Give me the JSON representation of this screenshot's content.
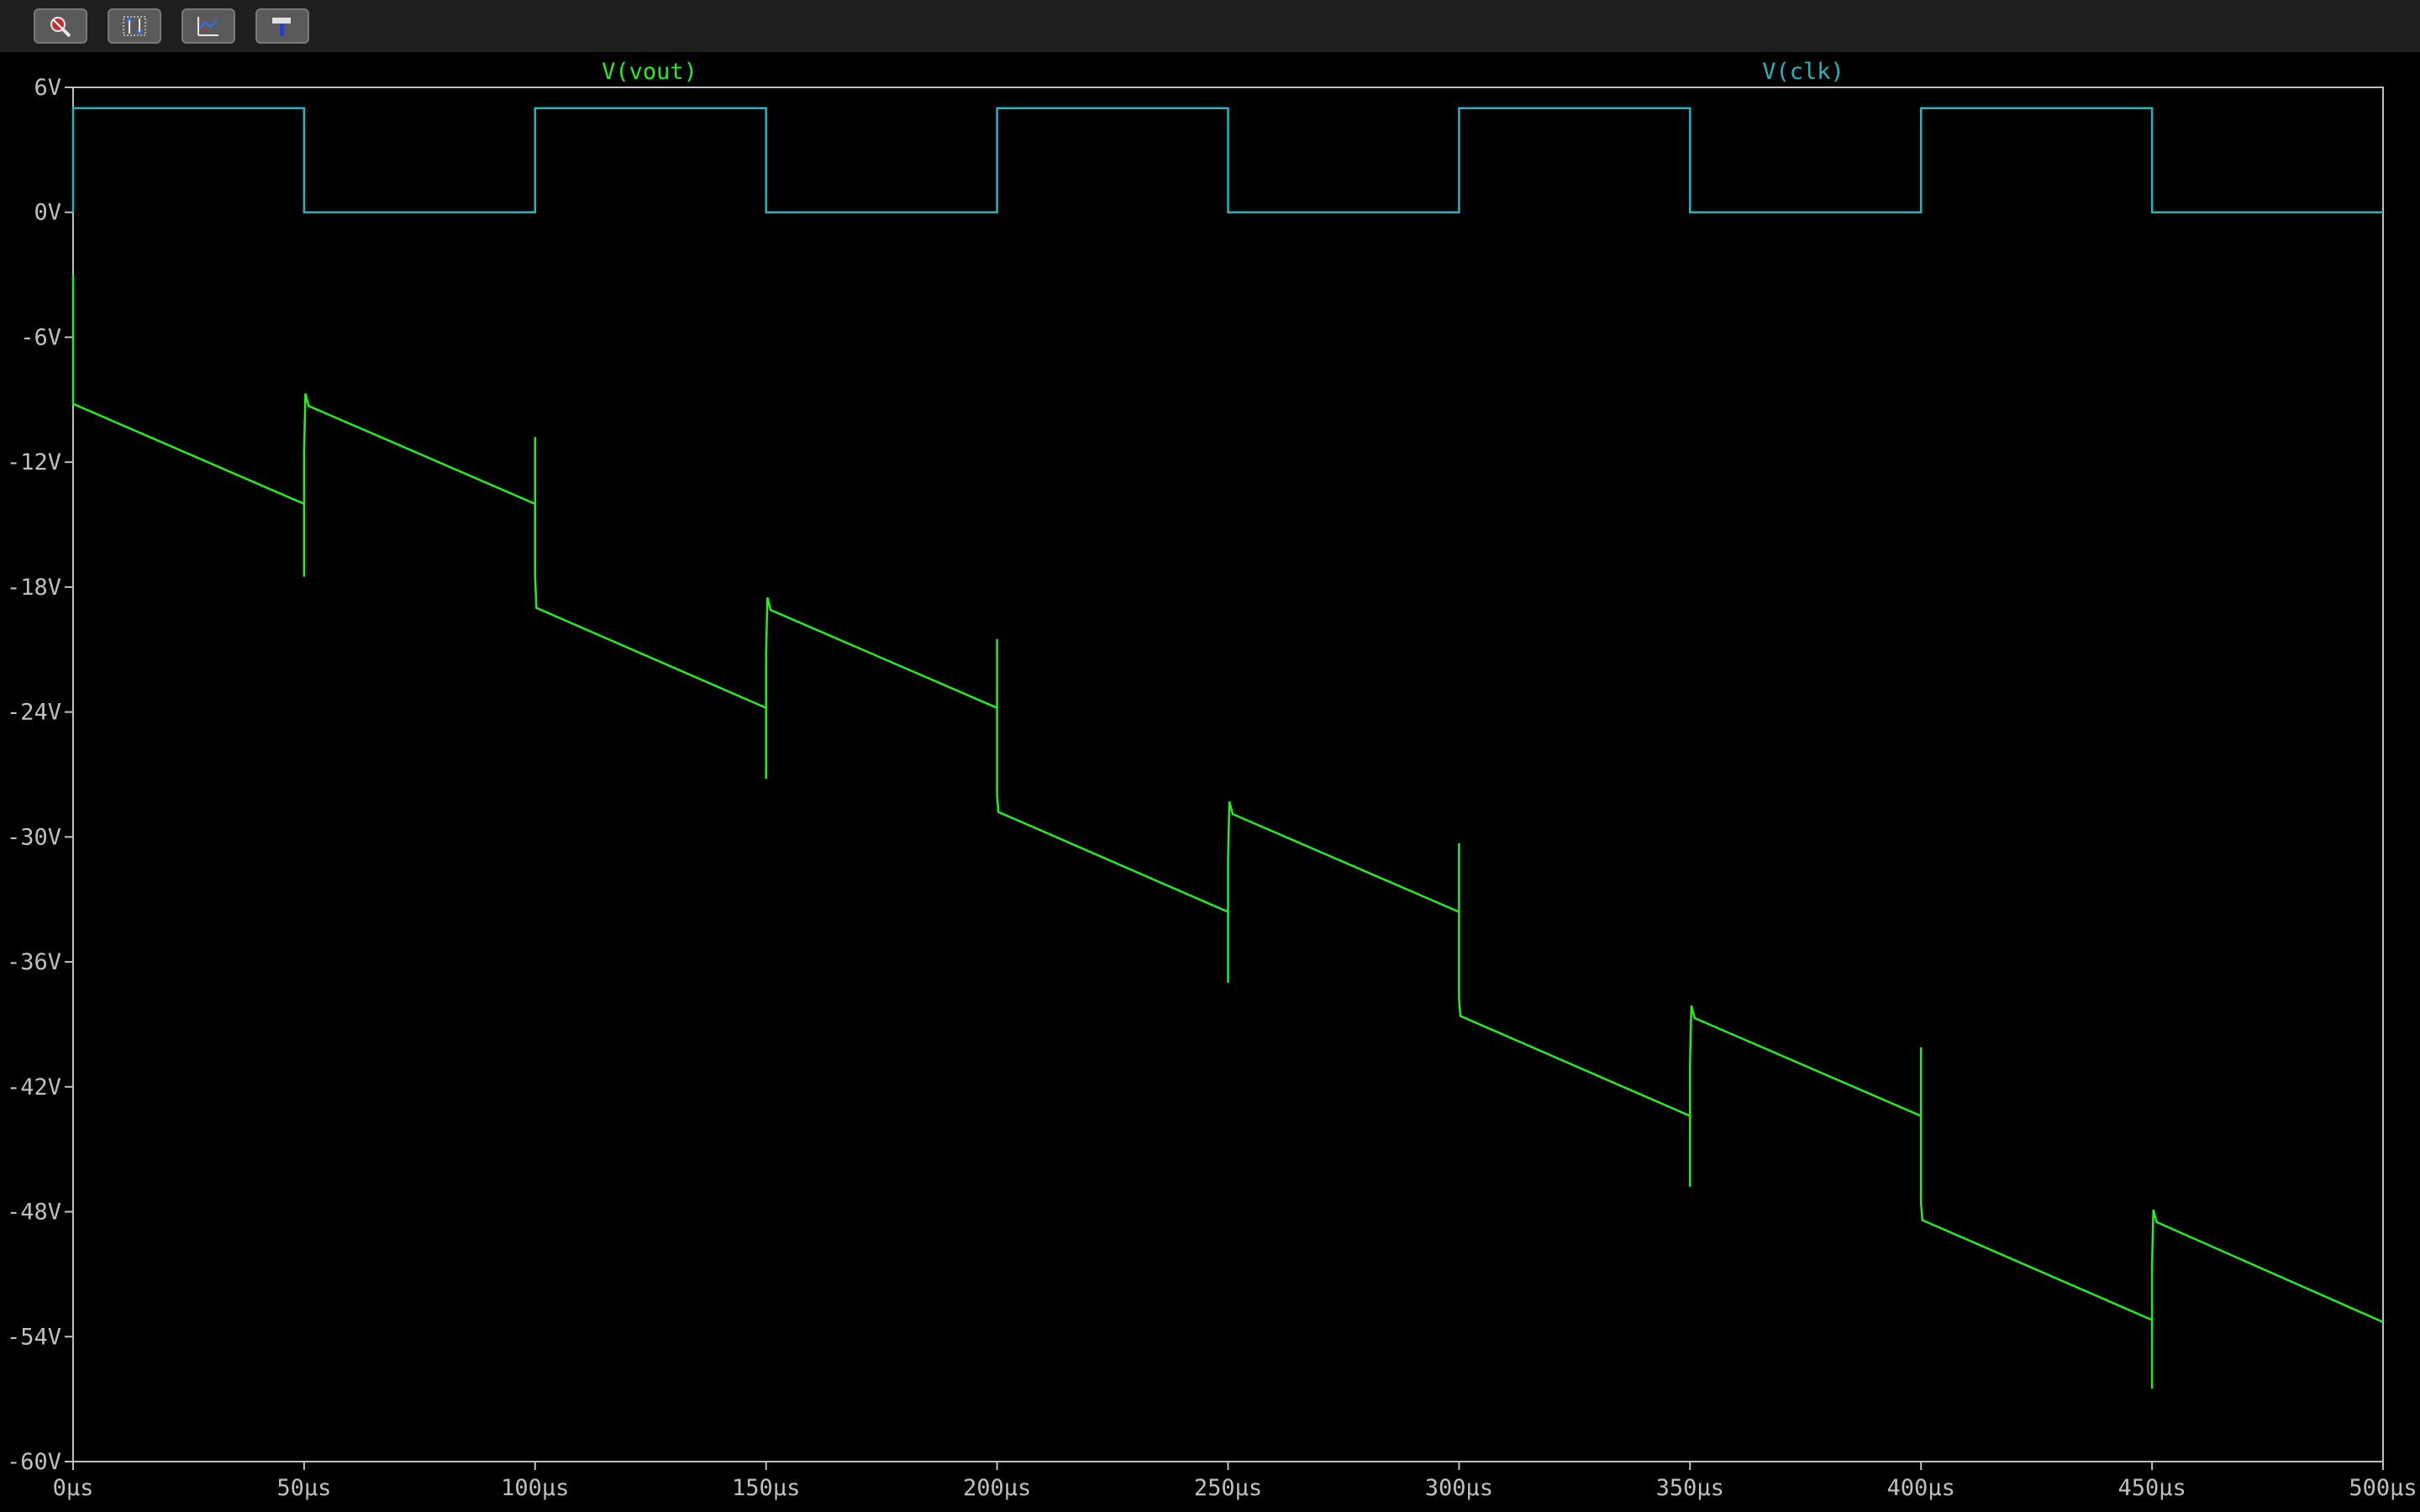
{
  "toolbar": {
    "items": [
      {
        "name": "zoom-cancel-icon"
      },
      {
        "name": "autoscale-y-icon"
      },
      {
        "name": "autoscale-x-icon"
      },
      {
        "name": "hammer-icon"
      }
    ]
  },
  "colors": {
    "background": "#000000",
    "axis": "#c0c0c0",
    "vout": "#22ee22",
    "clk": "#20b8c0",
    "toolbar": "#1e1e1e",
    "button": "#5a5a5a"
  },
  "chart_data": {
    "type": "line",
    "xlim": [
      0,
      500
    ],
    "ylim": [
      -60,
      6
    ],
    "x_ticks": [
      0,
      50,
      100,
      150,
      200,
      250,
      300,
      350,
      400,
      450,
      500
    ],
    "x_tick_labels": [
      "0µs",
      "50µs",
      "100µs",
      "150µs",
      "200µs",
      "250µs",
      "300µs",
      "350µs",
      "400µs",
      "450µs",
      "500µs"
    ],
    "y_ticks": [
      6,
      0,
      -6,
      -12,
      -18,
      -24,
      -30,
      -36,
      -42,
      -48,
      -54,
      -60
    ],
    "y_tick_labels": [
      "6V",
      "0V",
      "-6V",
      "-12V",
      "-18V",
      "-24V",
      "-30V",
      "-36V",
      "-42V",
      "-48V",
      "-54V",
      "-60V"
    ],
    "grid": false,
    "series": [
      {
        "name": "V(vout)",
        "color": "#22ee22",
        "points": [
          [
            0,
            -3.0
          ],
          [
            0,
            -9.2
          ],
          [
            50,
            -14.0
          ],
          [
            50,
            -17.5
          ],
          [
            50,
            -11.5
          ],
          [
            50.3,
            -8.7
          ],
          [
            51,
            -9.3
          ],
          [
            100,
            -14.0
          ],
          [
            100,
            -10.8
          ],
          [
            100,
            -17.5
          ],
          [
            100.3,
            -19.0
          ],
          [
            150,
            -23.8
          ],
          [
            150,
            -27.2
          ],
          [
            150,
            -21.2
          ],
          [
            150.3,
            -18.5
          ],
          [
            151,
            -19.1
          ],
          [
            200,
            -23.8
          ],
          [
            200,
            -20.5
          ],
          [
            200,
            -28.0
          ],
          [
            200.3,
            -28.8
          ],
          [
            250,
            -33.6
          ],
          [
            250,
            -37.0
          ],
          [
            250,
            -31.0
          ],
          [
            250.3,
            -28.3
          ],
          [
            251,
            -28.9
          ],
          [
            300,
            -33.6
          ],
          [
            300,
            -30.3
          ],
          [
            300,
            -37.8
          ],
          [
            300.3,
            -38.6
          ],
          [
            350,
            -43.4
          ],
          [
            350,
            -46.8
          ],
          [
            350,
            -40.8
          ],
          [
            350.3,
            -38.1
          ],
          [
            351,
            -38.7
          ],
          [
            400,
            -43.4
          ],
          [
            400,
            -40.1
          ],
          [
            400,
            -47.6
          ],
          [
            400.3,
            -48.4
          ],
          [
            450,
            -53.2
          ],
          [
            450,
            -56.5
          ],
          [
            450,
            -50.6
          ],
          [
            450.3,
            -47.9
          ],
          [
            451,
            -48.5
          ],
          [
            500,
            -53.3
          ]
        ]
      },
      {
        "name": "V(clk)",
        "color": "#20b8c0",
        "points": [
          [
            0,
            0
          ],
          [
            0,
            5
          ],
          [
            50,
            5
          ],
          [
            50,
            0
          ],
          [
            100,
            0
          ],
          [
            100,
            5
          ],
          [
            150,
            5
          ],
          [
            150,
            0
          ],
          [
            200,
            0
          ],
          [
            200,
            5
          ],
          [
            250,
            5
          ],
          [
            250,
            0
          ],
          [
            300,
            0
          ],
          [
            300,
            5
          ],
          [
            350,
            5
          ],
          [
            350,
            0
          ],
          [
            400,
            0
          ],
          [
            400,
            5
          ],
          [
            450,
            5
          ],
          [
            450,
            0
          ],
          [
            500,
            0
          ]
        ]
      }
    ]
  }
}
